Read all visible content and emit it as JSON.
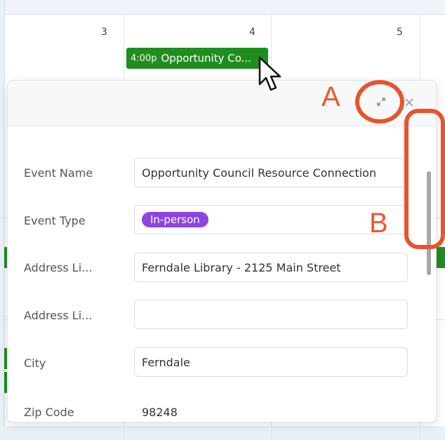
{
  "calendar": {
    "days": [
      "3",
      "4",
      "5"
    ],
    "event": {
      "time": "4:00p",
      "title": "Opportunity Co..."
    }
  },
  "modal": {
    "fields": [
      {
        "label": "Event Name",
        "value": "Opportunity Council Resource Connection"
      },
      {
        "label": "Event Type",
        "value": "In-person"
      },
      {
        "label": "Address Li...",
        "value": "Ferndale Library - 2125 Main Street"
      },
      {
        "label": "Address Li...",
        "value": ""
      },
      {
        "label": "City",
        "value": "Ferndale"
      },
      {
        "label": "Zip Code",
        "value": "98248"
      }
    ],
    "type_pill_color": "#8d44e0"
  },
  "annotations": {
    "a": "A",
    "b": "B",
    "color": "#ea5a2d"
  },
  "icons": [
    "expand-icon",
    "close-icon",
    "mouse-cursor-icon"
  ]
}
